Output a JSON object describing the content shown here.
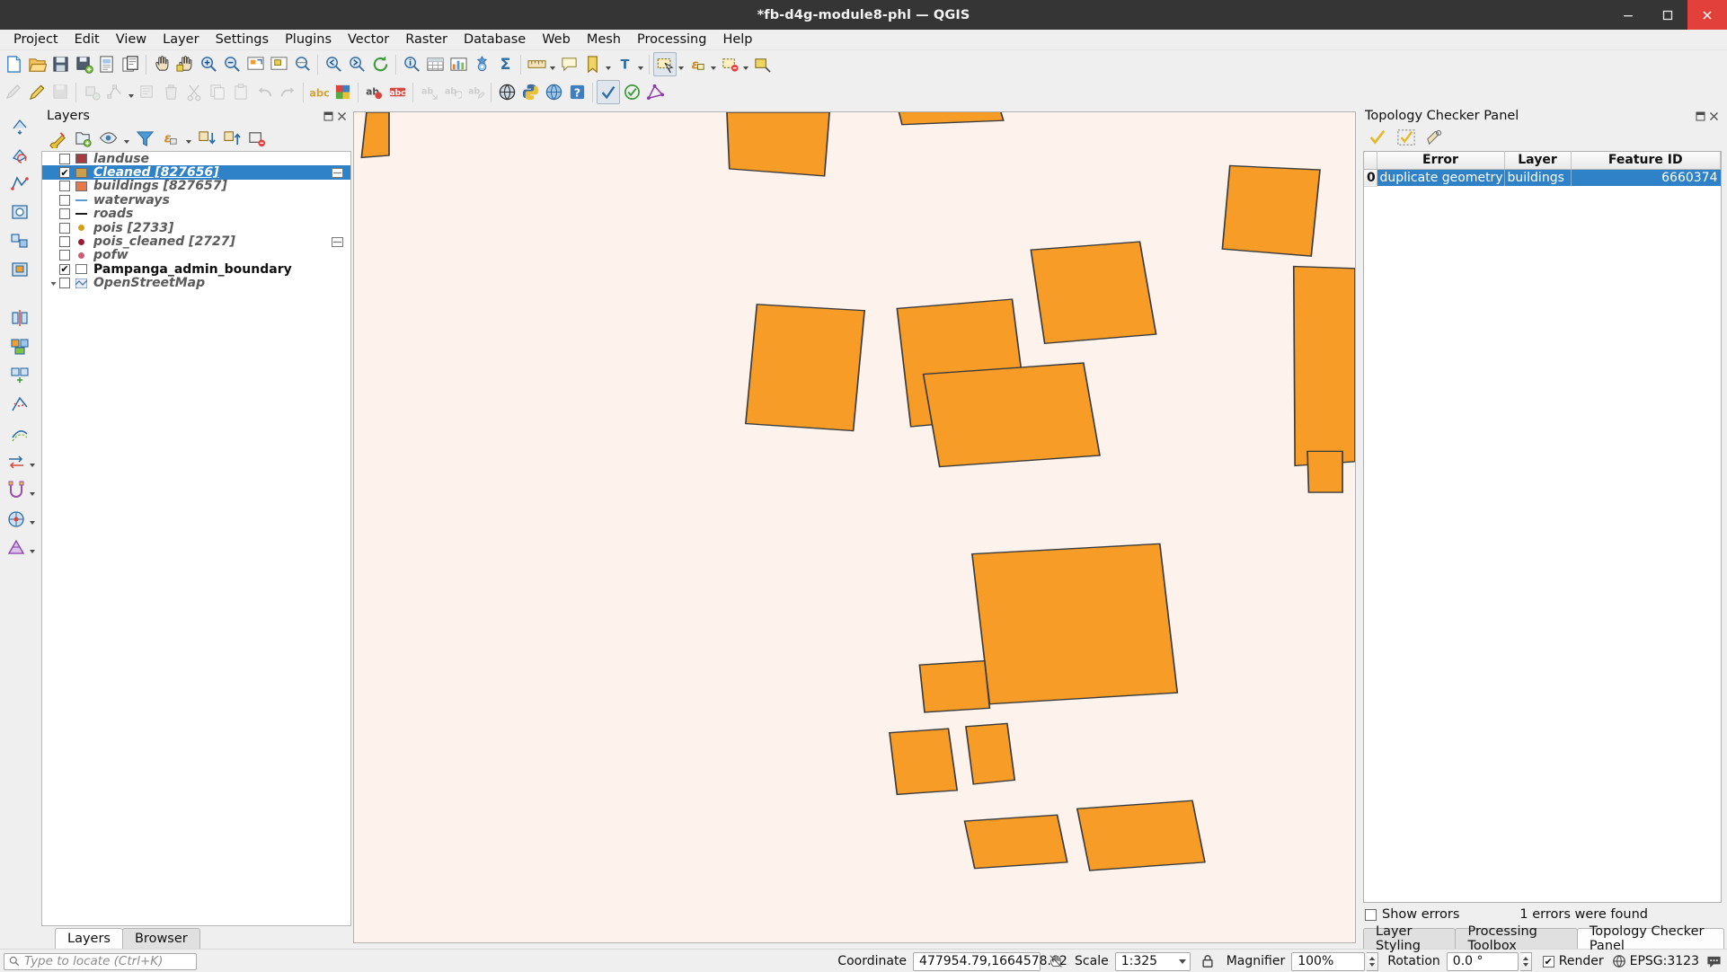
{
  "window": {
    "title": "*fb-d4g-module8-phl — QGIS",
    "minimize": "–",
    "maximize": "□",
    "close": "✕"
  },
  "menubar": {
    "items": [
      "Project",
      "Edit",
      "View",
      "Layer",
      "Settings",
      "Plugins",
      "Vector",
      "Raster",
      "Database",
      "Web",
      "Mesh",
      "Processing",
      "Help"
    ]
  },
  "layers_panel": {
    "title": "Layers",
    "toolbar_icons": [
      "open-layer-styling-icon",
      "add-group-icon",
      "manage-map-themes-icon",
      "filter-legend-icon",
      "filter-legend-expression-icon",
      "expand-all-icon",
      "collapse-all-icon",
      "remove-layer-icon"
    ],
    "items": [
      {
        "label": "landuse",
        "checked": false,
        "symbol": "swatch",
        "color": "#a63b42",
        "selected": false,
        "editing": false,
        "bold": false
      },
      {
        "label": "Cleaned [827656]",
        "checked": true,
        "symbol": "swatch",
        "color": "#cba049",
        "selected": true,
        "editing": true,
        "bold": false
      },
      {
        "label": "buildings [827657]",
        "checked": false,
        "symbol": "swatch",
        "color": "#e8774a",
        "selected": false,
        "editing": false,
        "bold": false
      },
      {
        "label": "waterways",
        "checked": false,
        "symbol": "line",
        "color": "#5b9bd5",
        "selected": false,
        "editing": false,
        "bold": false
      },
      {
        "label": "roads",
        "checked": false,
        "symbol": "line",
        "color": "#1d1d1d",
        "selected": false,
        "editing": false,
        "bold": false
      },
      {
        "label": "pois [2733]",
        "checked": false,
        "symbol": "dot",
        "color": "#d5a017",
        "selected": false,
        "editing": false,
        "bold": false
      },
      {
        "label": "pois_cleaned [2727]",
        "checked": false,
        "symbol": "dot",
        "color": "#9b1b30",
        "selected": false,
        "editing": true,
        "bold": false
      },
      {
        "label": "pofw",
        "checked": false,
        "symbol": "dot",
        "color": "#cf5b7a",
        "selected": false,
        "editing": false,
        "bold": false
      },
      {
        "label": "Pampanga_admin_boundary",
        "checked": true,
        "symbol": "swatch",
        "color": "#ffffff",
        "selected": false,
        "editing": false,
        "bold": true
      },
      {
        "label": "OpenStreetMap",
        "checked": false,
        "symbol": "raster",
        "color": "#4a6fa5",
        "selected": false,
        "editing": false,
        "bold": false,
        "expander": true
      }
    ],
    "tabs": [
      {
        "label": "Layers",
        "active": true
      },
      {
        "label": "Browser",
        "active": false
      }
    ]
  },
  "topology_panel": {
    "title": "Topology Checker Panel",
    "toolbar_icons": [
      "validate-all-icon",
      "validate-extent-icon",
      "configure-icon"
    ],
    "columns": [
      "Error",
      "Layer",
      "Feature ID"
    ],
    "rows": [
      {
        "index": "0",
        "error": "duplicate geometry",
        "layer": "buildings",
        "feature_id": "6660374",
        "selected": true
      }
    ],
    "show_errors_label": "Show errors",
    "show_errors_checked": false,
    "status_text": "1 errors were found"
  },
  "bottom_tabs": [
    {
      "label": "Layer Styling",
      "active": false
    },
    {
      "label": "Processing Toolbox",
      "active": false
    },
    {
      "label": "Topology Checker Panel",
      "active": true
    }
  ],
  "statusbar": {
    "locator_placeholder": "Type to locate (Ctrl+K)",
    "coordinate_label": "Coordinate",
    "coordinate_value": "477954.79,1664578.02",
    "scale_label": "Scale",
    "scale_value": "1:325",
    "magnifier_label": "Magnifier",
    "magnifier_value": "100%",
    "rotation_label": "Rotation",
    "rotation_value": "0.0 °",
    "render_label": "Render",
    "render_checked": true,
    "crs_label": "EPSG:3123",
    "lock_icon": "lock-icon",
    "messages_icon": "messages-icon",
    "globe_icon": "globe-icon",
    "extents_icon": "toggle-extents-icon"
  },
  "map": {
    "background": "#fdf2ec",
    "polygon_fill": "#f89c28",
    "polygon_stroke": "#3c3c3c",
    "polygons": [
      "M 10,0 L 28,0 L 28,42 L 6,44 Z",
      "M 298,0 L 380,0 L 376,62 L 300,55 Z",
      "M 434,-8 L 514,-12 L 519,8 L 438,12 Z",
      "M 700,52 L 772,56 L 765,140 L 694,133 Z",
      "M 541,134 L 628,126 L 641,216 L 552,225 Z",
      "M 434,191 L 526,182 L 538,296 L 445,306 Z",
      "M 751,150 L 800,152 L 800,340 L 752,344 Z",
      "M 322,187 L 408,193 L 399,310 L 313,303 Z",
      "M 455,255 L 583,244 L 596,334 L 468,345 Z",
      "M 762,330 L 790,330 L 790,370 L 763,370 Z",
      "M 494,430 L 644,420 L 658,565 L 508,576 Z",
      "M 452,538 L 504,534 L 508,580 L 456,584 Z",
      "M 428,604 L 475,600 L 482,660 L 434,664 Z",
      "M 489,598 L 522,595 L 528,650 L 495,654 Z",
      "M 488,690 L 562,684 L 570,730 L 496,736 Z",
      "M 578,678 L 670,670 L 680,730 L 588,738 Z"
    ]
  }
}
